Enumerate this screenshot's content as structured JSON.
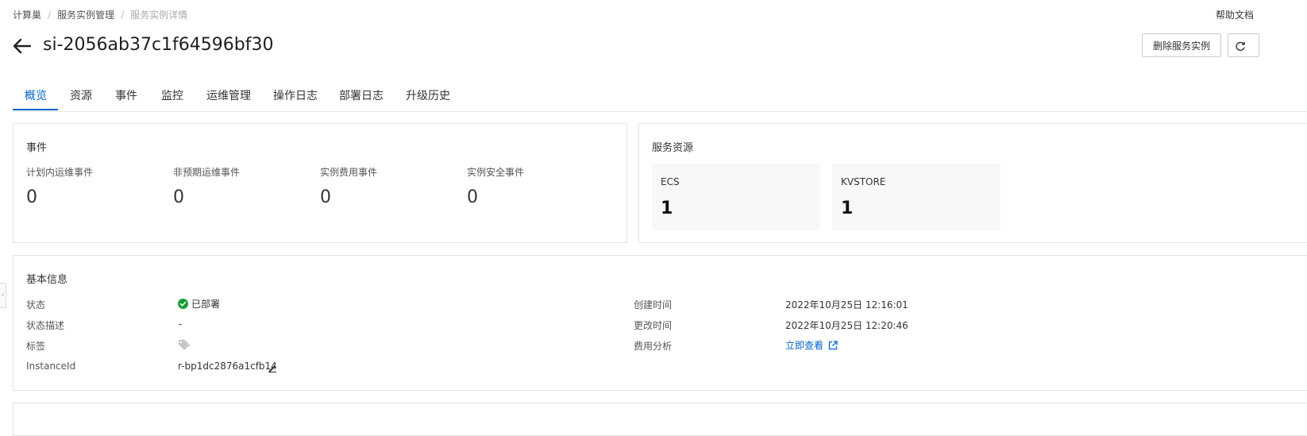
{
  "breadcrumb": {
    "items": [
      "计算巢",
      "服务实例管理"
    ],
    "current": "服务实例详情",
    "separator": "/"
  },
  "header": {
    "help_text": "帮助文档",
    "title": "si-2056ab37c1f64596bf30",
    "delete_button": "删除服务实例"
  },
  "tabs": [
    {
      "label": "概览",
      "active": true
    },
    {
      "label": "资源"
    },
    {
      "label": "事件"
    },
    {
      "label": "监控"
    },
    {
      "label": "运维管理"
    },
    {
      "label": "操作日志"
    },
    {
      "label": "部署日志"
    },
    {
      "label": "升级历史"
    }
  ],
  "events_card": {
    "title": "事件",
    "items": [
      {
        "label": "计划内运维事件",
        "value": "0"
      },
      {
        "label": "非预期运维事件",
        "value": "0"
      },
      {
        "label": "实例费用事件",
        "value": "0"
      },
      {
        "label": "实例安全事件",
        "value": "0"
      }
    ]
  },
  "resources_card": {
    "title": "服务资源",
    "items": [
      {
        "name": "ECS",
        "count": "1"
      },
      {
        "name": "KVSTORE",
        "count": "1"
      }
    ]
  },
  "basic_info": {
    "title": "基本信息",
    "status_label": "状态",
    "status_value": "已部署",
    "status_desc_label": "状态描述",
    "status_desc_value": "-",
    "tags_label": "标签",
    "instance_id_label": "InstanceId",
    "instance_id_value": "r-bp1dc2876a1cfb14",
    "created_label": "创建时间",
    "created_value": "2022年10月25日 12:16:01",
    "modified_label": "更改时间",
    "modified_value": "2022年10月25日 12:20:46",
    "cost_label": "费用分析",
    "cost_link": "立即查看"
  },
  "colors": {
    "accent": "#0064c8",
    "success": "#1a9e3a",
    "border": "#e3e3e3",
    "tile_bg": "#f7f8fa"
  }
}
